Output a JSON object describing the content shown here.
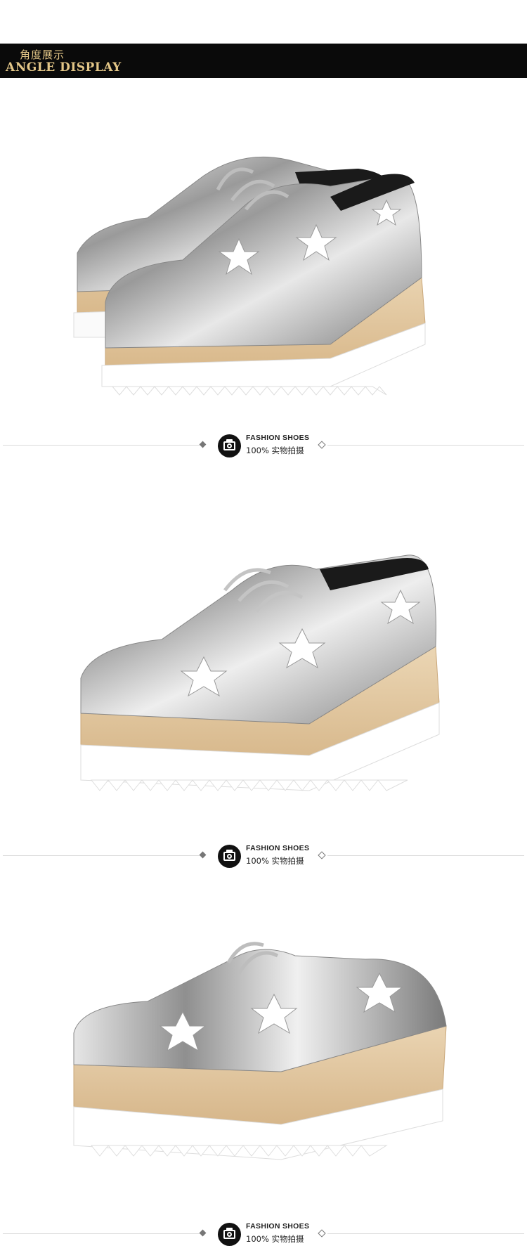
{
  "header": {
    "title_cn": "角度展示",
    "title_en": "ANGLE DISPLAY"
  },
  "dividers": [
    {
      "label_en": "FASHION SHOES",
      "label_cn": "100% 实物拍摄",
      "icon": "camera-icon"
    },
    {
      "label_en": "FASHION SHOES",
      "label_cn": "100% 实物拍摄",
      "icon": "camera-icon"
    },
    {
      "label_en": "FASHION SHOES",
      "label_cn": "100% 实物拍摄",
      "icon": "camera-icon"
    }
  ],
  "photos": [
    {
      "subject": "pair of silver metallic platform oxford shoes with white star patches"
    },
    {
      "subject": "single silver metallic platform oxford shoe, side-front view"
    },
    {
      "subject": "single silver metallic platform oxford shoe, side view"
    }
  ],
  "colors": {
    "header_band": "#0a0a0a",
    "header_text": "#e3c687",
    "silver": "#c8c8c8",
    "wood": "#e3c9a3",
    "sole": "#ffffff"
  }
}
